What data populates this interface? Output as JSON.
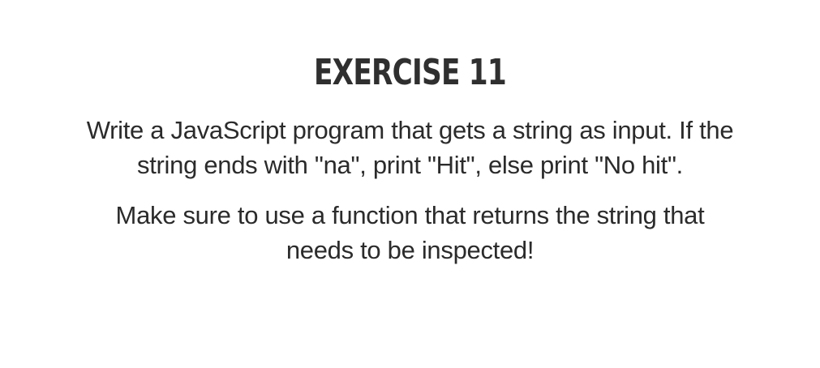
{
  "title": "EXERCISE 11",
  "paragraphs": [
    {
      "lines": [
        "Write a JavaScript program that gets a string as input. If the",
        "string ends with \"na\", print \"Hit\", else print \"No hit\"."
      ]
    },
    {
      "lines": [
        "Make sure to use a function that returns the string that",
        "needs to be inspected!"
      ]
    }
  ]
}
